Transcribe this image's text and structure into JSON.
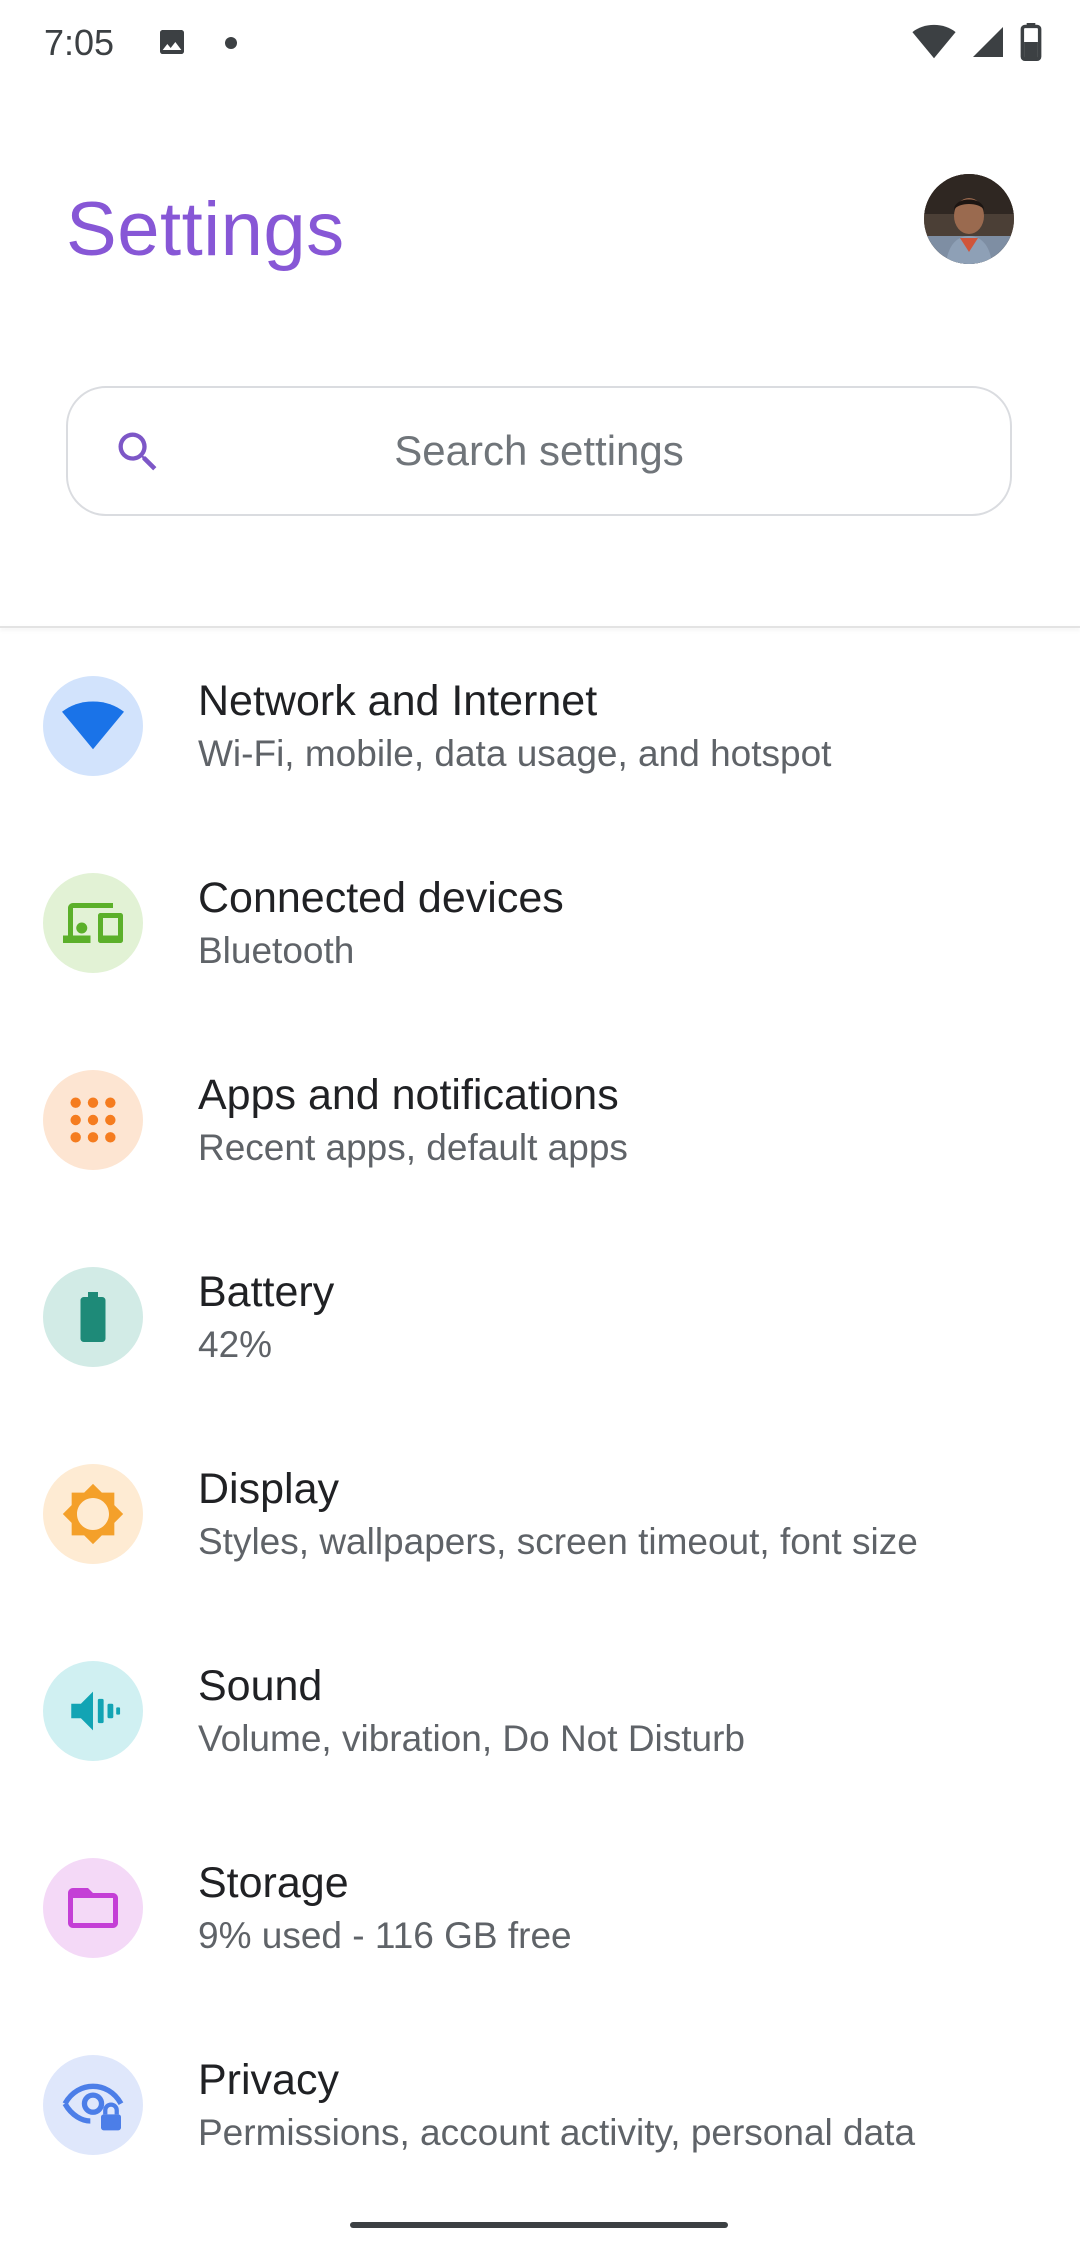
{
  "status_bar": {
    "time": "7:05"
  },
  "header": {
    "title": "Settings",
    "title_color": "#8757d6"
  },
  "search": {
    "placeholder": "Search settings"
  },
  "settings_items": [
    {
      "title": "Network and Internet",
      "subtitle": "Wi-Fi, mobile, data usage, and hotspot",
      "icon": "wifi-icon",
      "icon_color": "#1a73e8",
      "icon_bg": "#d2e3fc"
    },
    {
      "title": "Connected devices",
      "subtitle": "Bluetooth",
      "icon": "devices-icon",
      "icon_color": "#5bb02a",
      "icon_bg": "#e2f2d5"
    },
    {
      "title": "Apps and notifications",
      "subtitle": "Recent apps, default apps",
      "icon": "apps-grid-icon",
      "icon_color": "#f57c1f",
      "icon_bg": "#fde5d2"
    },
    {
      "title": "Battery",
      "subtitle": "42%",
      "icon": "battery-icon",
      "icon_color": "#1e8a78",
      "icon_bg": "#d2ebe6"
    },
    {
      "title": "Display",
      "subtitle": "Styles, wallpapers, screen timeout, font size",
      "icon": "brightness-icon",
      "icon_color": "#f4a02a",
      "icon_bg": "#feebd3"
    },
    {
      "title": "Sound",
      "subtitle": "Volume, vibration, Do Not Disturb",
      "icon": "volume-vibrate-icon",
      "icon_color": "#12a4b4",
      "icon_bg": "#d0f0f2"
    },
    {
      "title": "Storage",
      "subtitle": "9% used - 116 GB free",
      "icon": "folder-icon",
      "icon_color": "#c43fd6",
      "icon_bg": "#f4d9f7"
    },
    {
      "title": "Privacy",
      "subtitle": "Permissions, account activity, personal data",
      "icon": "privacy-eye-lock-icon",
      "icon_color": "#4c7ee8",
      "icon_bg": "#dfe7fb"
    }
  ]
}
